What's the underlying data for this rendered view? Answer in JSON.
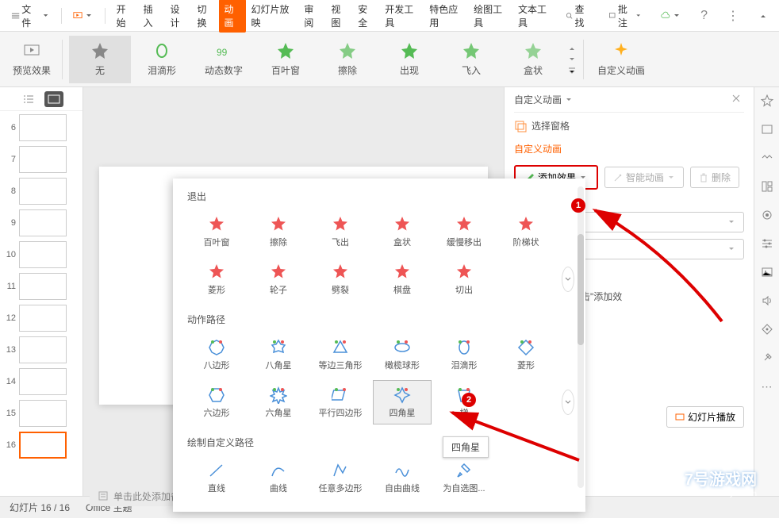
{
  "menubar": {
    "file": "文件",
    "items": [
      "开始",
      "插入",
      "设计",
      "切换",
      "动画",
      "幻灯片放映",
      "审阅",
      "视图",
      "安全",
      "开发工具",
      "特色应用",
      "绘图工具",
      "文本工具"
    ],
    "active_index": 4,
    "search": "查找",
    "annotate": "批注"
  },
  "toolbar": {
    "preview": "预览效果",
    "items": [
      "无",
      "泪滴形",
      "动态数字",
      "百叶窗",
      "擦除",
      "出现",
      "飞入",
      "盒状"
    ],
    "custom": "自定义动画"
  },
  "thumbs": {
    "numbers": [
      "6",
      "7",
      "8",
      "9",
      "10",
      "11",
      "12",
      "13",
      "14",
      "15",
      "16"
    ],
    "selected": 10
  },
  "side": {
    "title": "自定义动画",
    "select_pane": "选择窗格",
    "custom_anim": "自定义动画",
    "add_effect": "添加效果",
    "smart_anim": "智能动画",
    "delete": "删除",
    "desc": "个元素，然后单击\"添加效",
    "play": "幻灯片播放"
  },
  "popup": {
    "exit_title": "退出",
    "exit_items": [
      "百叶窗",
      "擦除",
      "飞出",
      "盒状",
      "缓慢移出",
      "阶梯状",
      "菱形",
      "轮子",
      "劈裂",
      "棋盘",
      "切出"
    ],
    "path_title": "动作路径",
    "path_items": [
      "八边形",
      "八角星",
      "等边三角形",
      "橄榄球形",
      "泪滴形",
      "菱形",
      "六边形",
      "六角星",
      "平行四边形",
      "四角星",
      "梯"
    ],
    "selected_path": "四角星",
    "custom_path_title": "绘制自定义路径",
    "custom_items": [
      "直线",
      "曲线",
      "任意多边形",
      "自由曲线",
      "为自选图..."
    ],
    "tooltip": "四角星"
  },
  "badges": {
    "b1": "1",
    "b2": "2"
  },
  "notes": "单击此处添加备注",
  "status": {
    "slide": "幻灯片 16 / 16",
    "theme": "Office 主题"
  }
}
